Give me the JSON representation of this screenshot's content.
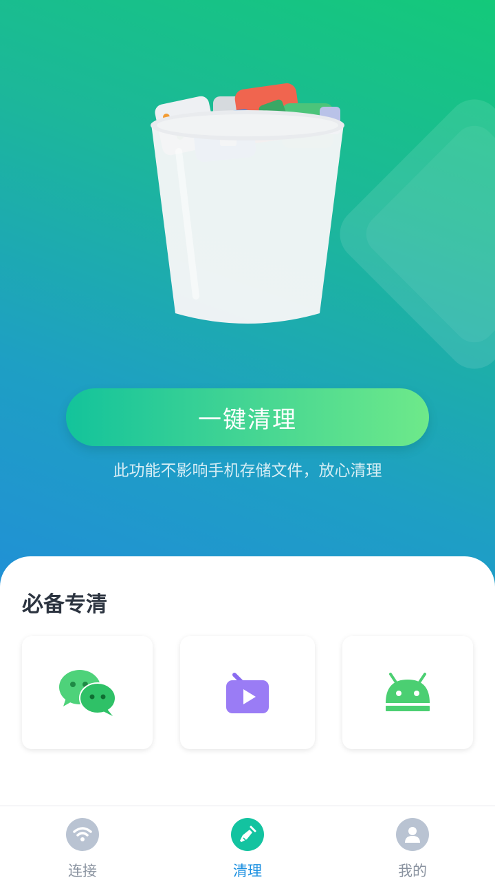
{
  "hero": {
    "clean_button_label": "一键清理",
    "hint_text": "此功能不影响手机存储文件，放心清理"
  },
  "section": {
    "title": "必备专清",
    "items": [
      {
        "icon": "wechat-icon"
      },
      {
        "icon": "video-icon"
      },
      {
        "icon": "android-icon"
      }
    ]
  },
  "tabbar": {
    "tabs": [
      {
        "label": "连接",
        "icon": "wifi-icon",
        "active": false
      },
      {
        "label": "清理",
        "icon": "broom-icon",
        "active": true
      },
      {
        "label": "我的",
        "icon": "user-icon",
        "active": false
      }
    ],
    "active_color": "#1a8fe0",
    "inactive_color": "#8a93a0"
  },
  "colors": {
    "brand_green": "#13c39b",
    "hero_top": "#14c97a",
    "hero_bottom": "#2190d6"
  }
}
